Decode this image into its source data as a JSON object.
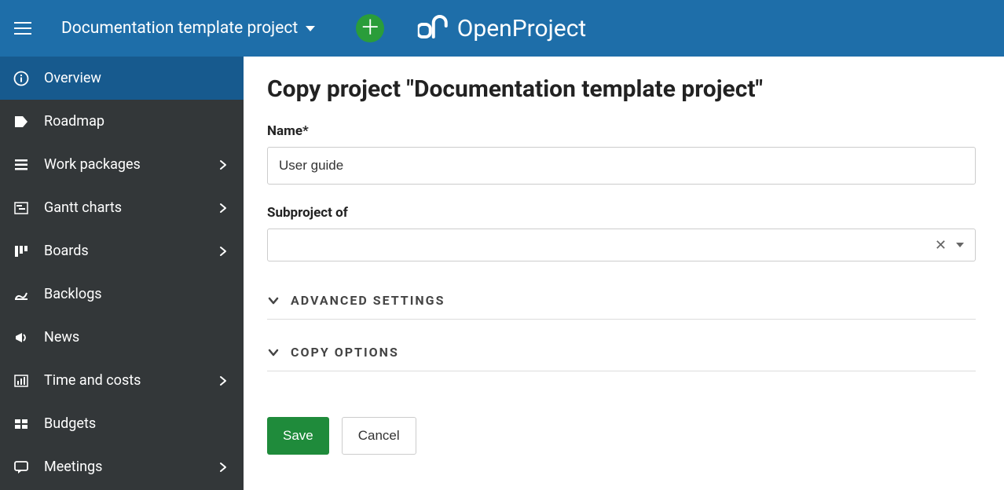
{
  "header": {
    "project_title": "Documentation template project",
    "brand": "OpenProject"
  },
  "sidebar": {
    "items": [
      {
        "label": "Overview",
        "icon": "info-circle-icon",
        "active": true,
        "has_arrow": false
      },
      {
        "label": "Roadmap",
        "icon": "tag-icon",
        "active": false,
        "has_arrow": false
      },
      {
        "label": "Work packages",
        "icon": "list-icon",
        "active": false,
        "has_arrow": true
      },
      {
        "label": "Gantt charts",
        "icon": "gantt-icon",
        "active": false,
        "has_arrow": true
      },
      {
        "label": "Boards",
        "icon": "boards-icon",
        "active": false,
        "has_arrow": true
      },
      {
        "label": "Backlogs",
        "icon": "backlogs-icon",
        "active": false,
        "has_arrow": false
      },
      {
        "label": "News",
        "icon": "megaphone-icon",
        "active": false,
        "has_arrow": false
      },
      {
        "label": "Time and costs",
        "icon": "chart-icon",
        "active": false,
        "has_arrow": true
      },
      {
        "label": "Budgets",
        "icon": "budget-icon",
        "active": false,
        "has_arrow": false
      },
      {
        "label": "Meetings",
        "icon": "meetings-icon",
        "active": false,
        "has_arrow": true
      }
    ]
  },
  "main": {
    "heading": "Copy project \"Documentation template project\"",
    "name_label": "Name*",
    "name_value": "User guide",
    "subproject_label": "Subproject of",
    "subproject_value": "",
    "advanced_label": "ADVANCED SETTINGS",
    "copy_options_label": "COPY OPTIONS",
    "save_label": "Save",
    "cancel_label": "Cancel"
  }
}
